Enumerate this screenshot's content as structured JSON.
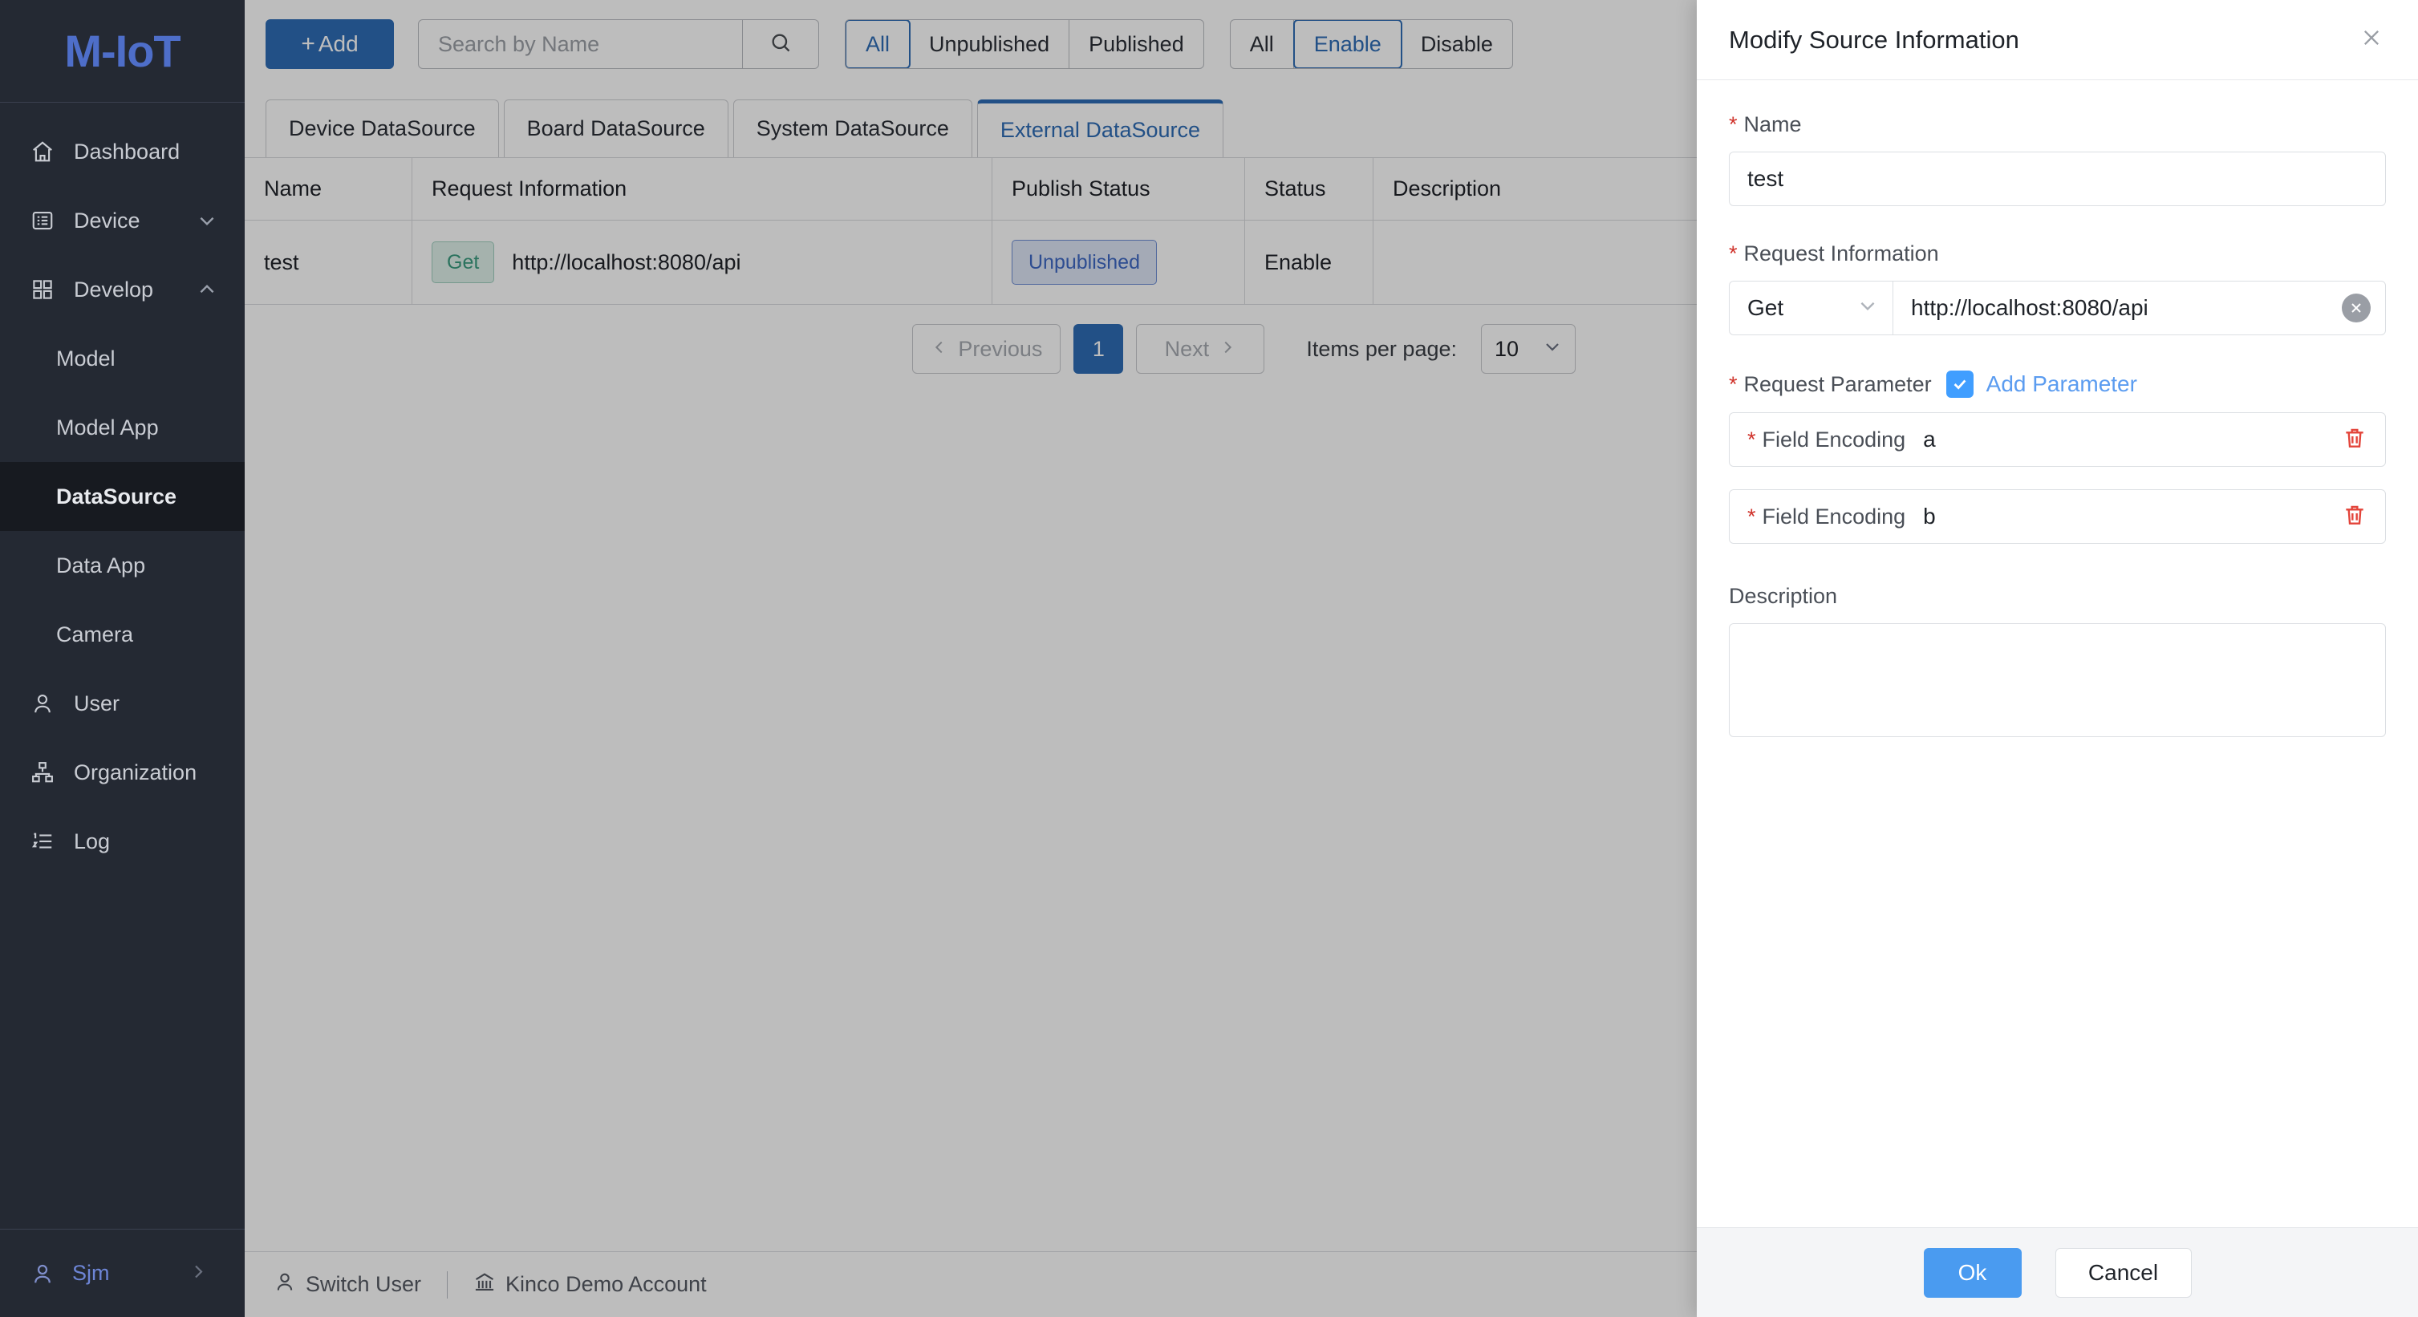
{
  "brand": {
    "name": "M-IoT"
  },
  "sidebar": {
    "items": [
      {
        "label": "Dashboard",
        "icon": "home-icon",
        "level": "top",
        "chevron": "",
        "active": false
      },
      {
        "label": "Device",
        "icon": "device-list-icon",
        "level": "top",
        "chevron": "chevron-down-icon",
        "active": false
      },
      {
        "label": "Develop",
        "icon": "grid-icon",
        "level": "top",
        "chevron": "chevron-up-icon",
        "active": false
      },
      {
        "label": "Model",
        "icon": "",
        "level": "sub",
        "chevron": "",
        "active": false
      },
      {
        "label": "Model App",
        "icon": "",
        "level": "sub",
        "chevron": "",
        "active": false
      },
      {
        "label": "DataSource",
        "icon": "",
        "level": "sub",
        "chevron": "",
        "active": true
      },
      {
        "label": "Data App",
        "icon": "",
        "level": "sub",
        "chevron": "",
        "active": false
      },
      {
        "label": "Camera",
        "icon": "",
        "level": "sub",
        "chevron": "",
        "active": false
      },
      {
        "label": "User",
        "icon": "user-icon",
        "level": "top",
        "chevron": "",
        "active": false
      },
      {
        "label": "Organization",
        "icon": "org-tree-icon",
        "level": "top",
        "chevron": "",
        "active": false
      },
      {
        "label": "Log",
        "icon": "list-ordered-icon",
        "level": "top",
        "chevron": "",
        "active": false
      }
    ],
    "footer": {
      "username": "Sjm",
      "arrow": "chevron-right-icon"
    }
  },
  "toolbar": {
    "add_label": "Add",
    "search_placeholder": "Search by Name",
    "search_value": "",
    "publish_filters": [
      {
        "label": "All",
        "selected": true
      },
      {
        "label": "Unpublished",
        "selected": false
      },
      {
        "label": "Published",
        "selected": false
      }
    ],
    "status_filters": [
      {
        "label": "All",
        "selected": false
      },
      {
        "label": "Enable",
        "selected": true
      },
      {
        "label": "Disable",
        "selected": false
      }
    ]
  },
  "tabs": [
    {
      "label": "Device DataSource",
      "active": false
    },
    {
      "label": "Board DataSource",
      "active": false
    },
    {
      "label": "System DataSource",
      "active": false
    },
    {
      "label": "External DataSource",
      "active": true
    }
  ],
  "table": {
    "columns": [
      "Name",
      "Request Information",
      "Publish Status",
      "Status",
      "Description"
    ],
    "rows": [
      {
        "name": "test",
        "method": "Get",
        "url": "http://localhost:8080/api",
        "publish_status": "Unpublished",
        "status": "Enable",
        "description": ""
      }
    ]
  },
  "pagination": {
    "previous_label": "Previous",
    "current_page": "1",
    "next_label": "Next",
    "items_per_page_label": "Items per page:",
    "items_per_page_value": "10"
  },
  "statusbar": {
    "switch_user_label": "Switch User",
    "account_label": "Kinco Demo Account"
  },
  "drawer": {
    "title": "Modify Source Information",
    "name_label": "Name",
    "name_value": "test",
    "request_info_label": "Request Information",
    "method_value": "Get",
    "url_value": "http://localhost:8080/api",
    "request_parameter_label": "Request Parameter",
    "add_parameter_label": "Add Parameter",
    "parameters": [
      {
        "label": "Field Encoding",
        "value": "a"
      },
      {
        "label": "Field Encoding",
        "value": "b"
      }
    ],
    "description_label": "Description",
    "description_value": "",
    "ok_label": "Ok",
    "cancel_label": "Cancel"
  },
  "colors": {
    "brand_blue": "#4e6ec9",
    "primary_blue": "#2f6cb5",
    "accent_blue": "#409eff",
    "sidebar_bg": "#242933",
    "required_red": "#d0342c",
    "get_green": "#3b9b7f"
  }
}
